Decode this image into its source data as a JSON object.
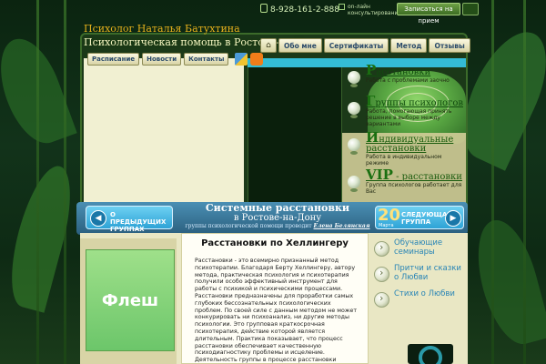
{
  "header": {
    "phone": "8-928-161-2-888",
    "online_label_line1": "on-лайн",
    "online_label_line2": "консультирование",
    "signup_label": "Записаться на прием",
    "site_title": "Психолог Наталья Батухтина",
    "site_subtitle": "Психологическая помощь в Ростове-на-Дону"
  },
  "mainnav": {
    "home_icon": "home-icon",
    "items": [
      {
        "label": "Обо мне"
      },
      {
        "label": "Сертификаты"
      },
      {
        "label": "Метод"
      },
      {
        "label": "Отзывы"
      }
    ]
  },
  "subnav": {
    "items": [
      {
        "label": "Расписание"
      },
      {
        "label": "Новости"
      },
      {
        "label": "Контакты"
      }
    ],
    "icons": [
      "sitemap-icon",
      "rss-icon"
    ]
  },
  "services": [
    {
      "initial": "Р",
      "title": "асстановки",
      "desc": "Работа с проблемами заочно"
    },
    {
      "initial": "Г",
      "title": "руппы психологов",
      "desc": "Работа, помогающая принять решение в выборе между вариантами"
    },
    {
      "initial": "И",
      "title": "ндивидуальные расстановки",
      "desc": "Работа в индивидуальном режиме"
    },
    {
      "initial": "VIP",
      "title": " - расстановки",
      "desc": "Группа психологов работает для Вас"
    }
  ],
  "banner": {
    "prev_label_line1": "О ПРЕДЫДУЩИХ",
    "prev_label_line2": "ГРУППАХ",
    "title": "Системные расстановки",
    "subtitle": "в Ростове-на-Дону",
    "note": "группы психологической помощи проводит",
    "note_author": "Елена Белянская",
    "next_day": "20",
    "next_month": "Марта",
    "next_label_line1": "СЛЕДУЮЩАЯ",
    "next_label_line2": "ГРУППА"
  },
  "flash": {
    "label": "Флеш"
  },
  "article": {
    "title": "Расстановки по Хеллингеру",
    "body": "Расстановки - это всемирно признанный метод психотерапии. Благодаря Берту Хеллингеру, автору метода, практическая психология и психотерапия получили особо эффективный инструмент для работы с психикой и психическими процессами. Расстановки предназначены для проработки самых глубоких бессознательных психологических проблем. По своей силе с данным методом не может конкурировать ни психоанализ, ни другие методы психологии. Это групповая краткосрочная психотерапия, действие которой является длительным. Практика показывает, что процесс расстановки обеспечивает качественную психодиагностику проблемы и исцеление. Деятельность группы в процессе расстановки"
  },
  "right_links": [
    {
      "label": "Обучающие семинары"
    },
    {
      "label": "Притчи и сказки о Любви"
    },
    {
      "label": "Стихи о Любви"
    }
  ]
}
